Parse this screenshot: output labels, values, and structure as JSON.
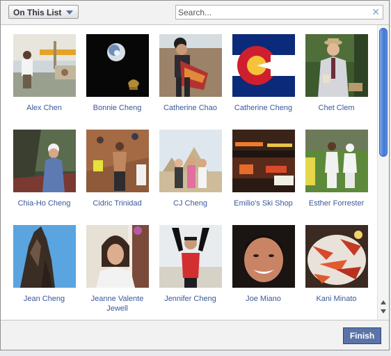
{
  "toolbar": {
    "list_filter_label": "On This List",
    "search_placeholder": "Search...",
    "search_value": ""
  },
  "friends": [
    {
      "name": "Alex Chen"
    },
    {
      "name": "Bonnie Cheng"
    },
    {
      "name": "Catherine Chao"
    },
    {
      "name": "Catherine Cheng"
    },
    {
      "name": "Chet Clem"
    },
    {
      "name": "Chia-Ho Cheng"
    },
    {
      "name": "Cidric Trinidad"
    },
    {
      "name": "CJ Cheng"
    },
    {
      "name": "Emilio's Ski Shop"
    },
    {
      "name": "Esther Forrester"
    },
    {
      "name": "Jean Cheng"
    },
    {
      "name": "Jeanne Valente Jewell"
    },
    {
      "name": "Jennifer Cheng"
    },
    {
      "name": "Joe Miano"
    },
    {
      "name": "Kani Minato"
    }
  ],
  "footer": {
    "finish_label": "Finish"
  },
  "colors": {
    "link": "#3b5998",
    "button": "#5b74a8"
  }
}
